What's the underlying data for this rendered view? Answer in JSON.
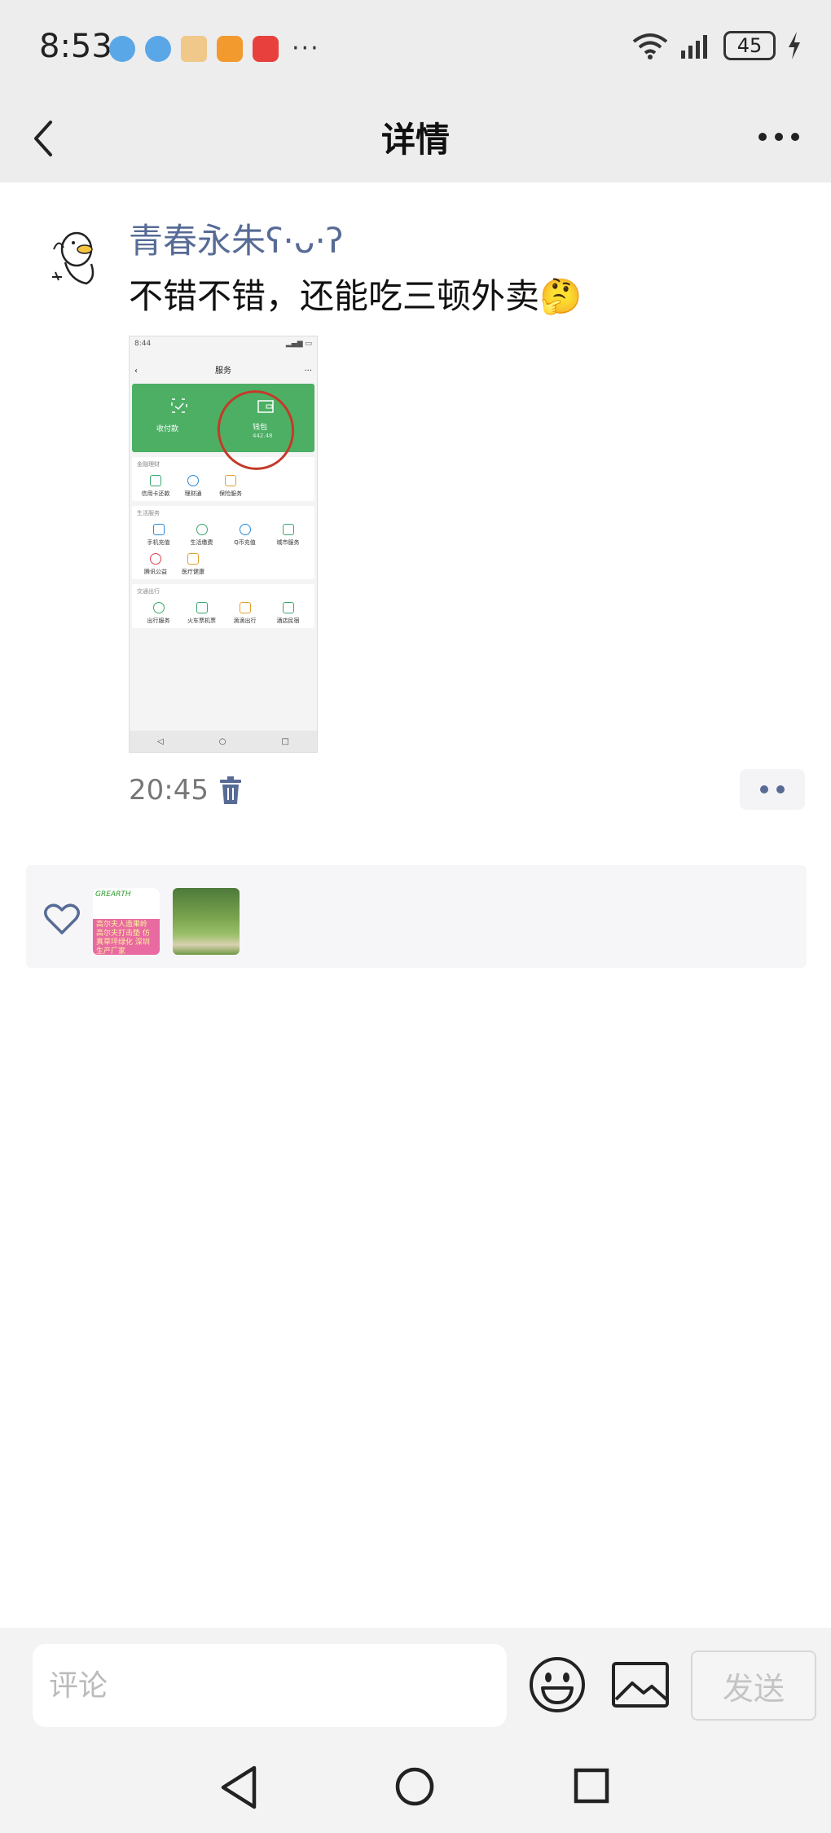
{
  "status_bar": {
    "time": "8:53",
    "more": "···",
    "battery": "45"
  },
  "header": {
    "title": "详情"
  },
  "post": {
    "nickname": "青春永朱ʕ·ᴗ·ʔ",
    "text": "不错不错，还能吃三顿外卖🤔",
    "time": "20:45",
    "image": {
      "status_time": "8:44",
      "title": "服务",
      "green_items": [
        "收付款",
        "钱包"
      ],
      "wallet_amount": "442.48",
      "sections": [
        {
          "title": "金融理财",
          "items": [
            "信用卡还款",
            "理财通",
            "保险服务"
          ]
        },
        {
          "title": "生活服务",
          "items": [
            "手机充值",
            "生活缴费",
            "Q币充值",
            "城市服务",
            "腾讯公益",
            "医疗健康"
          ]
        },
        {
          "title": "交通出行",
          "items": [
            "出行服务",
            "火车票机票",
            "滴滴出行",
            "酒店民宿"
          ]
        }
      ]
    }
  },
  "likes": {
    "avatar1_brand": "GREARTH",
    "avatar1_text": "高尔夫人造果岭 高尔夫打击垫 仿真草坪绿化 深圳生产厂家"
  },
  "bottom_bar": {
    "comment_placeholder": "评论",
    "send_label": "发送"
  },
  "colors": {
    "nickname": "#576b95",
    "topbar": "#ededed",
    "wallet_green": "#4caf64"
  }
}
